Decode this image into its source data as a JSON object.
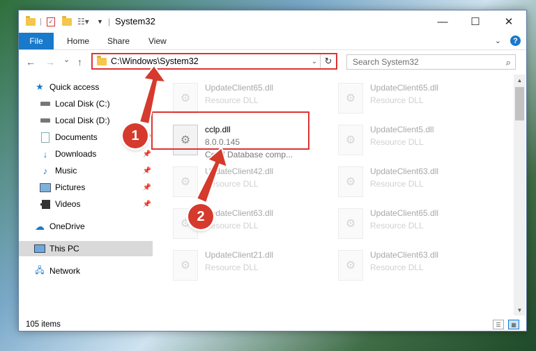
{
  "window": {
    "title": "System32",
    "minimize_glyph": "—",
    "maximize_glyph": "☐",
    "close_glyph": "✕"
  },
  "ribbon": {
    "tabs": [
      {
        "label": "File"
      },
      {
        "label": "Share"
      },
      {
        "label": "Home"
      },
      {
        "label": "View"
      }
    ],
    "file_label": "File",
    "home_label": "Home",
    "share_label": "Share",
    "view_label": "View",
    "help_glyph": "?"
  },
  "navigation": {
    "back_glyph": "←",
    "forward_glyph": "→",
    "recent_glyph": "⌄",
    "up_glyph": "↑",
    "address": "C:\\Windows\\System32",
    "refresh_glyph": "↻",
    "search_placeholder": "Search System32",
    "search_glyph": "⌕"
  },
  "sidebar": {
    "items": [
      {
        "label": "Quick access"
      },
      {
        "label": "Local Disk (C:)"
      },
      {
        "label": "Local Disk (D:)"
      },
      {
        "label": "Documents"
      },
      {
        "label": "Downloads"
      },
      {
        "label": "Music"
      },
      {
        "label": "Pictures"
      },
      {
        "label": "Videos"
      },
      {
        "label": "OneDrive"
      },
      {
        "label": "This PC"
      },
      {
        "label": "Network"
      }
    ]
  },
  "files": {
    "left": [
      {
        "name": "UpdateClient65.dll",
        "type": "Resource DLL"
      },
      {
        "name": "cclp.dll",
        "version": "8.0.0.145",
        "description": "Corel Database comp..."
      },
      {
        "name": "UpdateClient42.dll",
        "type": "Resource DLL"
      },
      {
        "name": "UpdateClient63.dll",
        "type": "Resource DLL"
      },
      {
        "name": "UpdateClient21.dll",
        "type": "Resource DLL"
      }
    ],
    "right": [
      {
        "name": "UpdateClient65.dll",
        "type": "Resource DLL"
      },
      {
        "name": "UpdateClient5.dll",
        "type": "Resource DLL"
      },
      {
        "name": "UpdateClient63.dll",
        "type": "Resource DLL"
      },
      {
        "name": "UpdateClient65.dll",
        "type": "Resource DLL"
      },
      {
        "name": "UpdateClient63.dll",
        "type": "Resource DLL"
      }
    ]
  },
  "status": {
    "item_count": "105 items"
  },
  "annotations": {
    "step1": "1",
    "step2": "2",
    "color": "#d53a2c"
  },
  "colors": {
    "accent": "#1979ca",
    "highlight": "#dd3333",
    "folder": "#f3c74d"
  }
}
